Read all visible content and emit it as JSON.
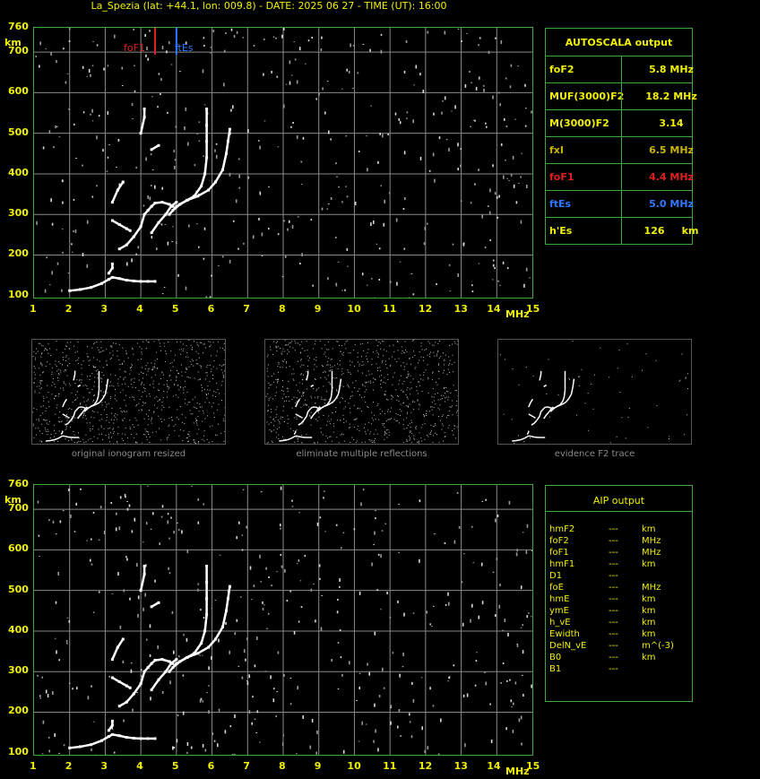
{
  "header": {
    "title": "La_Spezia (lat: +44.1, lon: 009.8) - DATE: 2025 06 27 - TIME (UT): 16:00"
  },
  "colors": {
    "axis": "#f0f000",
    "grid": "#8a8a8a",
    "trace": "#ffffff",
    "foF1": "#e02020",
    "ftEs": "#2f78ff",
    "panel": "#3fa63f"
  },
  "chart_data": [
    {
      "type": "scatter",
      "name": "main",
      "x_ticks": [
        "1",
        "2",
        "3",
        "4",
        "5",
        "6",
        "7",
        "8",
        "9",
        "10",
        "11",
        "12",
        "13",
        "14",
        "15"
      ],
      "y_ticks": [
        "760",
        "700",
        "600",
        "500",
        "400",
        "300",
        "200",
        "100"
      ],
      "xlabel": "MHz",
      "ylabel": "km",
      "xlim": [
        1,
        15
      ],
      "ylim": [
        95,
        760
      ],
      "grid": true,
      "markers": [
        {
          "label": "foF1",
          "x": 4.4,
          "color": "#e02020"
        },
        {
          "label": "ftEs",
          "x": 5.0,
          "color": "#2f78ff"
        }
      ],
      "traces": [
        {
          "name": "Es",
          "points": [
            [
              2.0,
              112
            ],
            [
              2.3,
              115
            ],
            [
              2.6,
              120
            ],
            [
              2.9,
              130
            ],
            [
              3.1,
              140
            ],
            [
              3.2,
              145
            ],
            [
              3.4,
              142
            ],
            [
              3.6,
              138
            ],
            [
              3.8,
              136
            ],
            [
              4.0,
              135
            ],
            [
              4.2,
              135
            ],
            [
              4.4,
              135
            ]
          ]
        },
        {
          "name": "Es2",
          "points": [
            [
              3.1,
              155
            ],
            [
              3.2,
              168
            ],
            [
              3.2,
              178
            ]
          ]
        },
        {
          "name": "F1",
          "points": [
            [
              3.2,
              285
            ],
            [
              3.4,
              275
            ],
            [
              3.6,
              265
            ],
            [
              3.7,
              260
            ]
          ]
        },
        {
          "name": "F1b",
          "points": [
            [
              3.4,
              215
            ],
            [
              3.6,
              225
            ],
            [
              3.8,
              245
            ],
            [
              4.0,
              270
            ],
            [
              4.1,
              300
            ],
            [
              4.2,
              310
            ],
            [
              4.3,
              320
            ],
            [
              4.4,
              328
            ],
            [
              4.6,
              330
            ],
            [
              4.8,
              325
            ],
            [
              4.9,
              320
            ]
          ]
        },
        {
          "name": "F2o",
          "points": [
            [
              4.9,
              310
            ],
            [
              5.1,
              325
            ],
            [
              5.3,
              335
            ],
            [
              5.5,
              345
            ],
            [
              5.7,
              370
            ],
            [
              5.8,
              400
            ],
            [
              5.85,
              440
            ],
            [
              5.85,
              480
            ],
            [
              5.85,
              520
            ],
            [
              5.85,
              560
            ]
          ]
        },
        {
          "name": "F2x",
          "points": [
            [
              4.8,
              300
            ],
            [
              5.0,
              320
            ],
            [
              5.3,
              335
            ],
            [
              5.6,
              345
            ],
            [
              5.9,
              360
            ],
            [
              6.1,
              380
            ],
            [
              6.3,
              410
            ],
            [
              6.4,
              450
            ],
            [
              6.45,
              480
            ],
            [
              6.5,
              510
            ]
          ]
        },
        {
          "name": "F2b",
          "points": [
            [
              4.3,
              255
            ],
            [
              4.5,
              280
            ],
            [
              4.7,
              300
            ],
            [
              4.85,
              320
            ],
            [
              5.0,
              330
            ]
          ]
        },
        {
          "name": "hi",
          "points": [
            [
              3.2,
              330
            ],
            [
              3.35,
              360
            ],
            [
              3.5,
              380
            ]
          ]
        },
        {
          "name": "hi2",
          "points": [
            [
              4.0,
              500
            ],
            [
              4.1,
              540
            ],
            [
              4.1,
              560
            ]
          ]
        },
        {
          "name": "hi3",
          "points": [
            [
              4.3,
              460
            ],
            [
              4.5,
              470
            ]
          ]
        }
      ]
    }
  ],
  "autoscala": {
    "title": "AUTOSCALA output",
    "rows": [
      {
        "key": "foF2",
        "value": "5.8 MHz",
        "color": "#f0f000"
      },
      {
        "key": "MUF(3000)F2",
        "value": "18.2 MHz",
        "color": "#f0f000"
      },
      {
        "key": "M(3000)F2",
        "value": "3.14",
        "color": "#f0f000"
      },
      {
        "key": "fxI",
        "value": "6.5 MHz",
        "color": "#c8b400"
      },
      {
        "key": "foF1",
        "value": "4.4 MHz",
        "color": "#e02020"
      },
      {
        "key": "ftEs",
        "value": "5.0 MHz",
        "color": "#2f78ff"
      },
      {
        "key": "h'Es",
        "value": "126     km",
        "color": "#f0f000"
      }
    ]
  },
  "thumbnails": [
    {
      "caption": "original ionogram resized"
    },
    {
      "caption": "eliminate multiple reflections"
    },
    {
      "caption": "evidence F2 trace"
    }
  ],
  "aip": {
    "title": "AIP output",
    "rows": [
      {
        "key": "hmF2",
        "val": "---",
        "unit": "km"
      },
      {
        "key": "foF2",
        "val": "---",
        "unit": "MHz"
      },
      {
        "key": "foF1",
        "val": "---",
        "unit": "MHz"
      },
      {
        "key": "hmF1",
        "val": "---",
        "unit": "km"
      },
      {
        "key": "D1",
        "val": "---",
        "unit": ""
      },
      {
        "key": "foE",
        "val": "---",
        "unit": "MHz"
      },
      {
        "key": "hmE",
        "val": "---",
        "unit": "km"
      },
      {
        "key": "ymE",
        "val": "---",
        "unit": "km"
      },
      {
        "key": "h_vE",
        "val": "---",
        "unit": "km"
      },
      {
        "key": "Ewidth",
        "val": "---",
        "unit": "km"
      },
      {
        "key": "DelN_vE",
        "val": "---",
        "unit": "m^(-3)"
      },
      {
        "key": "B0",
        "val": "---",
        "unit": "km"
      },
      {
        "key": "B1",
        "val": "---",
        "unit": ""
      }
    ]
  }
}
